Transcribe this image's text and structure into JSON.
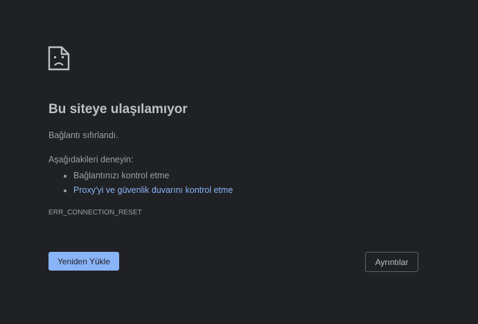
{
  "error": {
    "icon": "sad-page-icon",
    "title": "Bu siteye ulaşılamıyor",
    "reason": "Bağlantı sıfırlandı.",
    "try_heading": "Aşağıdakileri deneyin:",
    "suggestions": [
      {
        "label": "Bağlantınızı kontrol etme",
        "is_link": false
      },
      {
        "label": "Proxy'yi ve güvenlik duvarını kontrol etme",
        "is_link": true
      }
    ],
    "code": "ERR_CONNECTION_RESET"
  },
  "buttons": {
    "reload_label": "Yeniden Yükle",
    "details_label": "Ayrıntılar"
  },
  "colors": {
    "background": "#202124",
    "text": "#9aa0a6",
    "title": "#bdc1c6",
    "link": "#8ab4f8",
    "primary_button": "#8ab4f8"
  }
}
